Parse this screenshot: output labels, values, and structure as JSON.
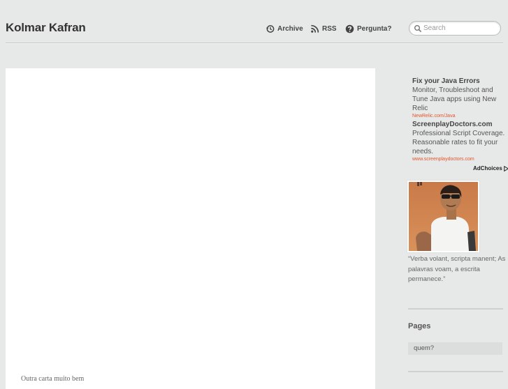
{
  "site": {
    "title": "Kolmar Kafran"
  },
  "nav": {
    "archive": "Archive",
    "rss": "RSS",
    "pergunta": "Pergunta?"
  },
  "search": {
    "placeholder": "Search"
  },
  "post": {
    "text": "Outra carta muito bem"
  },
  "ads": [
    {
      "title": "Fix your Java Errors",
      "body": "Monitor, Troubleshoot and Tune Java apps using New Relic",
      "url": "NewRelic.com/Java"
    },
    {
      "title": "ScreenplayDoctors.com",
      "body": "Professional Script Coverage. Reasonable rates to fit your needs.",
      "url": "www.screenplaydoctors.com"
    }
  ],
  "adchoices": "AdChoices",
  "sidebar": {
    "quote": "“Verba volant, scripta manent; As palavras voam, a escrita permanece.”",
    "pages_title": "Pages",
    "pages": [
      {
        "label": "quem?"
      }
    ]
  },
  "colors": {
    "background": "#e7e9e8",
    "ad_url": "#e2542a"
  }
}
